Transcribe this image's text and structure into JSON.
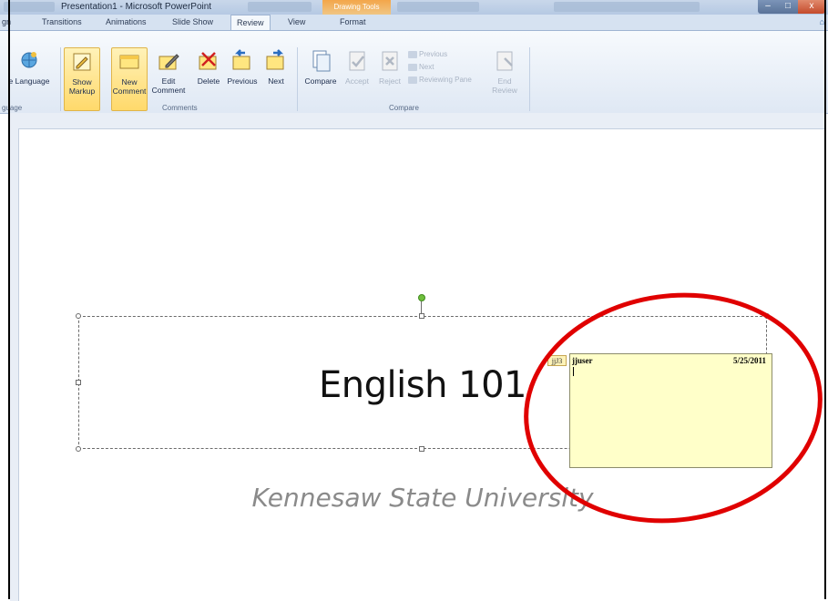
{
  "window": {
    "title": "Presentation1 - Microsoft PowerPoint",
    "contextual_tab": "Drawing Tools",
    "controls": {
      "minimize": "–",
      "maximize": "□",
      "close": "x"
    }
  },
  "tabs": [
    {
      "label": "gn"
    },
    {
      "label": "Transitions"
    },
    {
      "label": "Animations"
    },
    {
      "label": "Slide Show"
    },
    {
      "label": "Review"
    },
    {
      "label": "View"
    },
    {
      "label": "Format"
    }
  ],
  "help_icon": "⌂",
  "ribbon": {
    "language_group": {
      "language_label": "e Language",
      "group_label": "guage"
    },
    "comments_group": {
      "show_markup_line1": "Show",
      "show_markup_line2": "Markup",
      "new_comment_line1": "New",
      "new_comment_line2": "Comment",
      "edit_comment_line1": "Edit",
      "edit_comment_line2": "Comment",
      "delete_label": "Delete",
      "previous_label": "Previous",
      "next_label": "Next",
      "group_label": "Comments"
    },
    "compare_group": {
      "compare_label": "Compare",
      "accept_label": "Accept",
      "reject_label": "Reject",
      "previous_label": "Previous",
      "next_label": "Next",
      "reviewing_pane_label": "Reviewing Pane",
      "end_review_line1": "End",
      "end_review_line2": "Review",
      "group_label": "Compare"
    }
  },
  "slide": {
    "title": "English 101",
    "subtitle": "Kennesaw State University"
  },
  "comment": {
    "marker": "jjJ3",
    "author": "jjuser",
    "date": "5/25/2011",
    "text": ""
  },
  "colors": {
    "annotation": "#e00000",
    "comment_bg": "#ffffc9",
    "highlight": "#ffd96b"
  }
}
